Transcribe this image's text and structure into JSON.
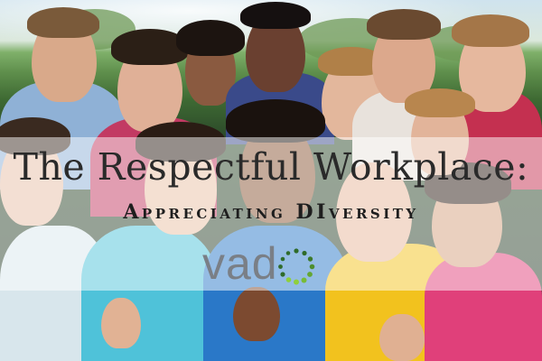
{
  "banner": {
    "title": "The Respectful Workplace:",
    "subtitle": "Appreciating DIversity"
  },
  "logo": {
    "wordmark": "vad",
    "mark_icon": "dotted-o-icon",
    "colors": {
      "wordmark": "#7a7f86",
      "dots_dark": "#2f6b2a",
      "dots_light": "#8fcf3c"
    }
  },
  "photo": {
    "subject": "crowd-of-smiling-people"
  }
}
